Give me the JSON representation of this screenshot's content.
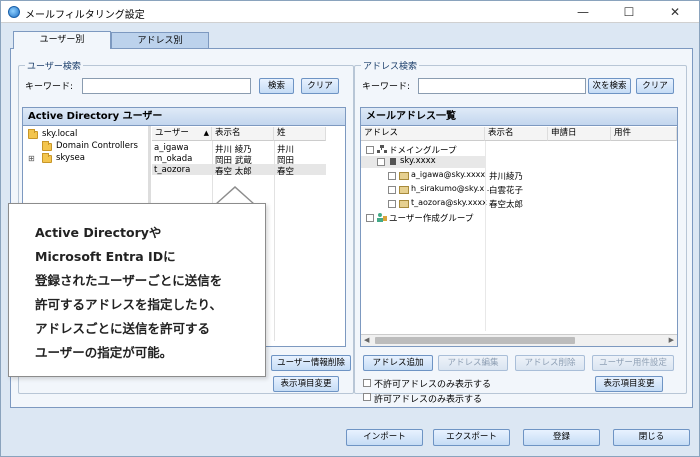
{
  "window": {
    "title": "メールフィルタリング設定",
    "minimize": "—",
    "maximize": "☐",
    "close": "✕"
  },
  "tabs": [
    {
      "label": "ユーザー別",
      "active": true
    },
    {
      "label": "アドレス別",
      "active": false
    }
  ],
  "user_search": {
    "group_label": "ユーザー検索",
    "keyword_label": "キーワード:",
    "keyword_value": "",
    "search_button": "検索",
    "clear_button": "クリア"
  },
  "ad_panel": {
    "header": "Active Directory ユーザー",
    "tree": [
      {
        "label": "sky.local",
        "expanded": true
      },
      {
        "label": "Domain Controllers"
      },
      {
        "label": "skysea",
        "expandable": true
      }
    ],
    "columns": [
      "ユーザー",
      "表示名",
      "姓"
    ],
    "rows": [
      {
        "user": "a_igawa",
        "display": "井川 綾乃",
        "last": "井川"
      },
      {
        "user": "m_okada",
        "display": "岡田 武蔵",
        "last": "岡田"
      },
      {
        "user": "t_aozora",
        "display": "春空 太郎",
        "last": "春空"
      }
    ],
    "delete_user_info_button": "ユーザー情報削除",
    "change_display_button": "表示項目変更"
  },
  "address_search": {
    "group_label": "アドレス検索",
    "keyword_label": "キーワード:",
    "keyword_value": "",
    "next_search_button": "次を検索",
    "clear_button": "クリア"
  },
  "mail_panel": {
    "header": "メールアドレス一覧",
    "columns": [
      "アドレス",
      "表示名",
      "申請日",
      "用件"
    ],
    "tree": [
      {
        "label": "ドメイングループ",
        "display": ""
      },
      {
        "label": "sky.xxxx",
        "display": ""
      },
      {
        "label": "a_igawa@sky.xxxx",
        "display": "井川綾乃"
      },
      {
        "label": "h_sirakumo@sky.x...",
        "display": "白雲花子"
      },
      {
        "label": "t_aozora@sky.xxxx",
        "display": "春空太郎"
      },
      {
        "label": "ユーザー作成グループ",
        "display": ""
      }
    ],
    "add_address_button": "アドレス追加",
    "edit_address_button": "アドレス編集",
    "delete_address_button": "アドレス削除",
    "user_requirement_button": "ユーザー用件設定",
    "change_display_button": "表示項目変更",
    "only_disallowed_checkbox": "不許可アドレスのみ表示する",
    "only_allowed_checkbox": "許可アドレスのみ表示する"
  },
  "footer": {
    "import_button": "インポート",
    "export_button": "エクスポート",
    "register_button": "登録",
    "close_button": "閉じる"
  },
  "callout": {
    "lines": [
      "Active Directoryや",
      "Microsoft Entra IDに",
      "登録されたユーザーごとに送信を",
      "許可するアドレスを指定したり、",
      "アドレスごとに送信を許可する",
      "ユーザーの指定が可能。"
    ]
  },
  "colors": {
    "window_bg": "#dce7f3",
    "panel_bg": "#f2f6fb",
    "border": "#7d99c0",
    "button_gradient_top": "#e8f2ff",
    "button_gradient_bottom": "#c5dcf5"
  }
}
